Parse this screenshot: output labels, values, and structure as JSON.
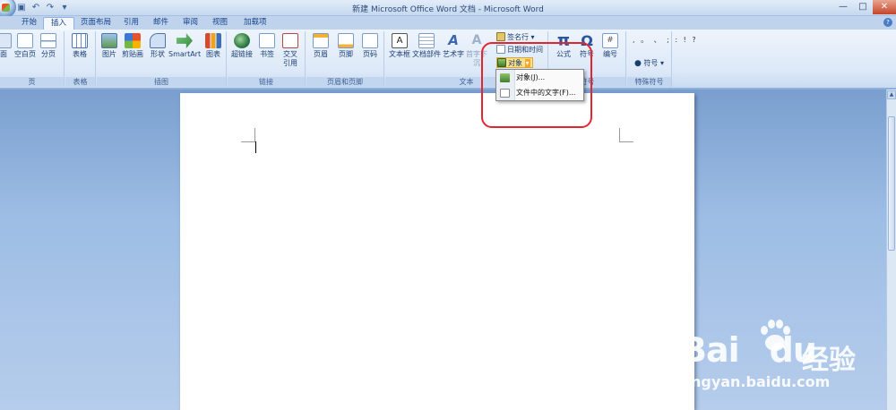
{
  "window": {
    "title": "新建 Microsoft Office Word 文档 - Microsoft Word",
    "qat": [
      "save",
      "undo",
      "redo",
      "customize"
    ],
    "controls": [
      "—",
      "□",
      "✕"
    ]
  },
  "tabs": [
    "开始",
    "插入",
    "页面布局",
    "引用",
    "邮件",
    "审阅",
    "视图",
    "加载项"
  ],
  "active_tab": "插入",
  "ribbon": {
    "page_group": {
      "label": "页",
      "buttons": [
        "面",
        "空白页",
        "分页"
      ]
    },
    "table_group": {
      "label": "表格",
      "buttons": [
        "表格"
      ]
    },
    "illustration_group": {
      "label": "插图",
      "buttons": [
        "图片",
        "剪贴画",
        "形状",
        "SmartArt",
        "图表"
      ]
    },
    "link_group": {
      "label": "链接",
      "buttons": [
        "超链接",
        "书签",
        "交叉",
        "引用"
      ]
    },
    "header_group": {
      "label": "页眉和页脚",
      "buttons": [
        "页眉",
        "页脚",
        "页码"
      ]
    },
    "text_group": {
      "label": "文本",
      "buttons": [
        "文本框",
        "文档部件",
        "艺术字",
        "首字下沉"
      ],
      "small": [
        "签名行",
        "日期和时间",
        "对象"
      ]
    },
    "symbols_group": {
      "label": "符号",
      "buttons": [
        "公式",
        "符号",
        "编号"
      ]
    },
    "special_group": {
      "label": "特殊符号",
      "button": "符号",
      "dots": ", 。 、 ; : ! ?"
    }
  },
  "dropdown": {
    "items": [
      "对象(J)...",
      "文件中的文字(F)..."
    ]
  },
  "watermark": {
    "logo": "Bai",
    "logo_tail": "du",
    "cn": "经验",
    "url": "jingyan.baidu.com"
  }
}
